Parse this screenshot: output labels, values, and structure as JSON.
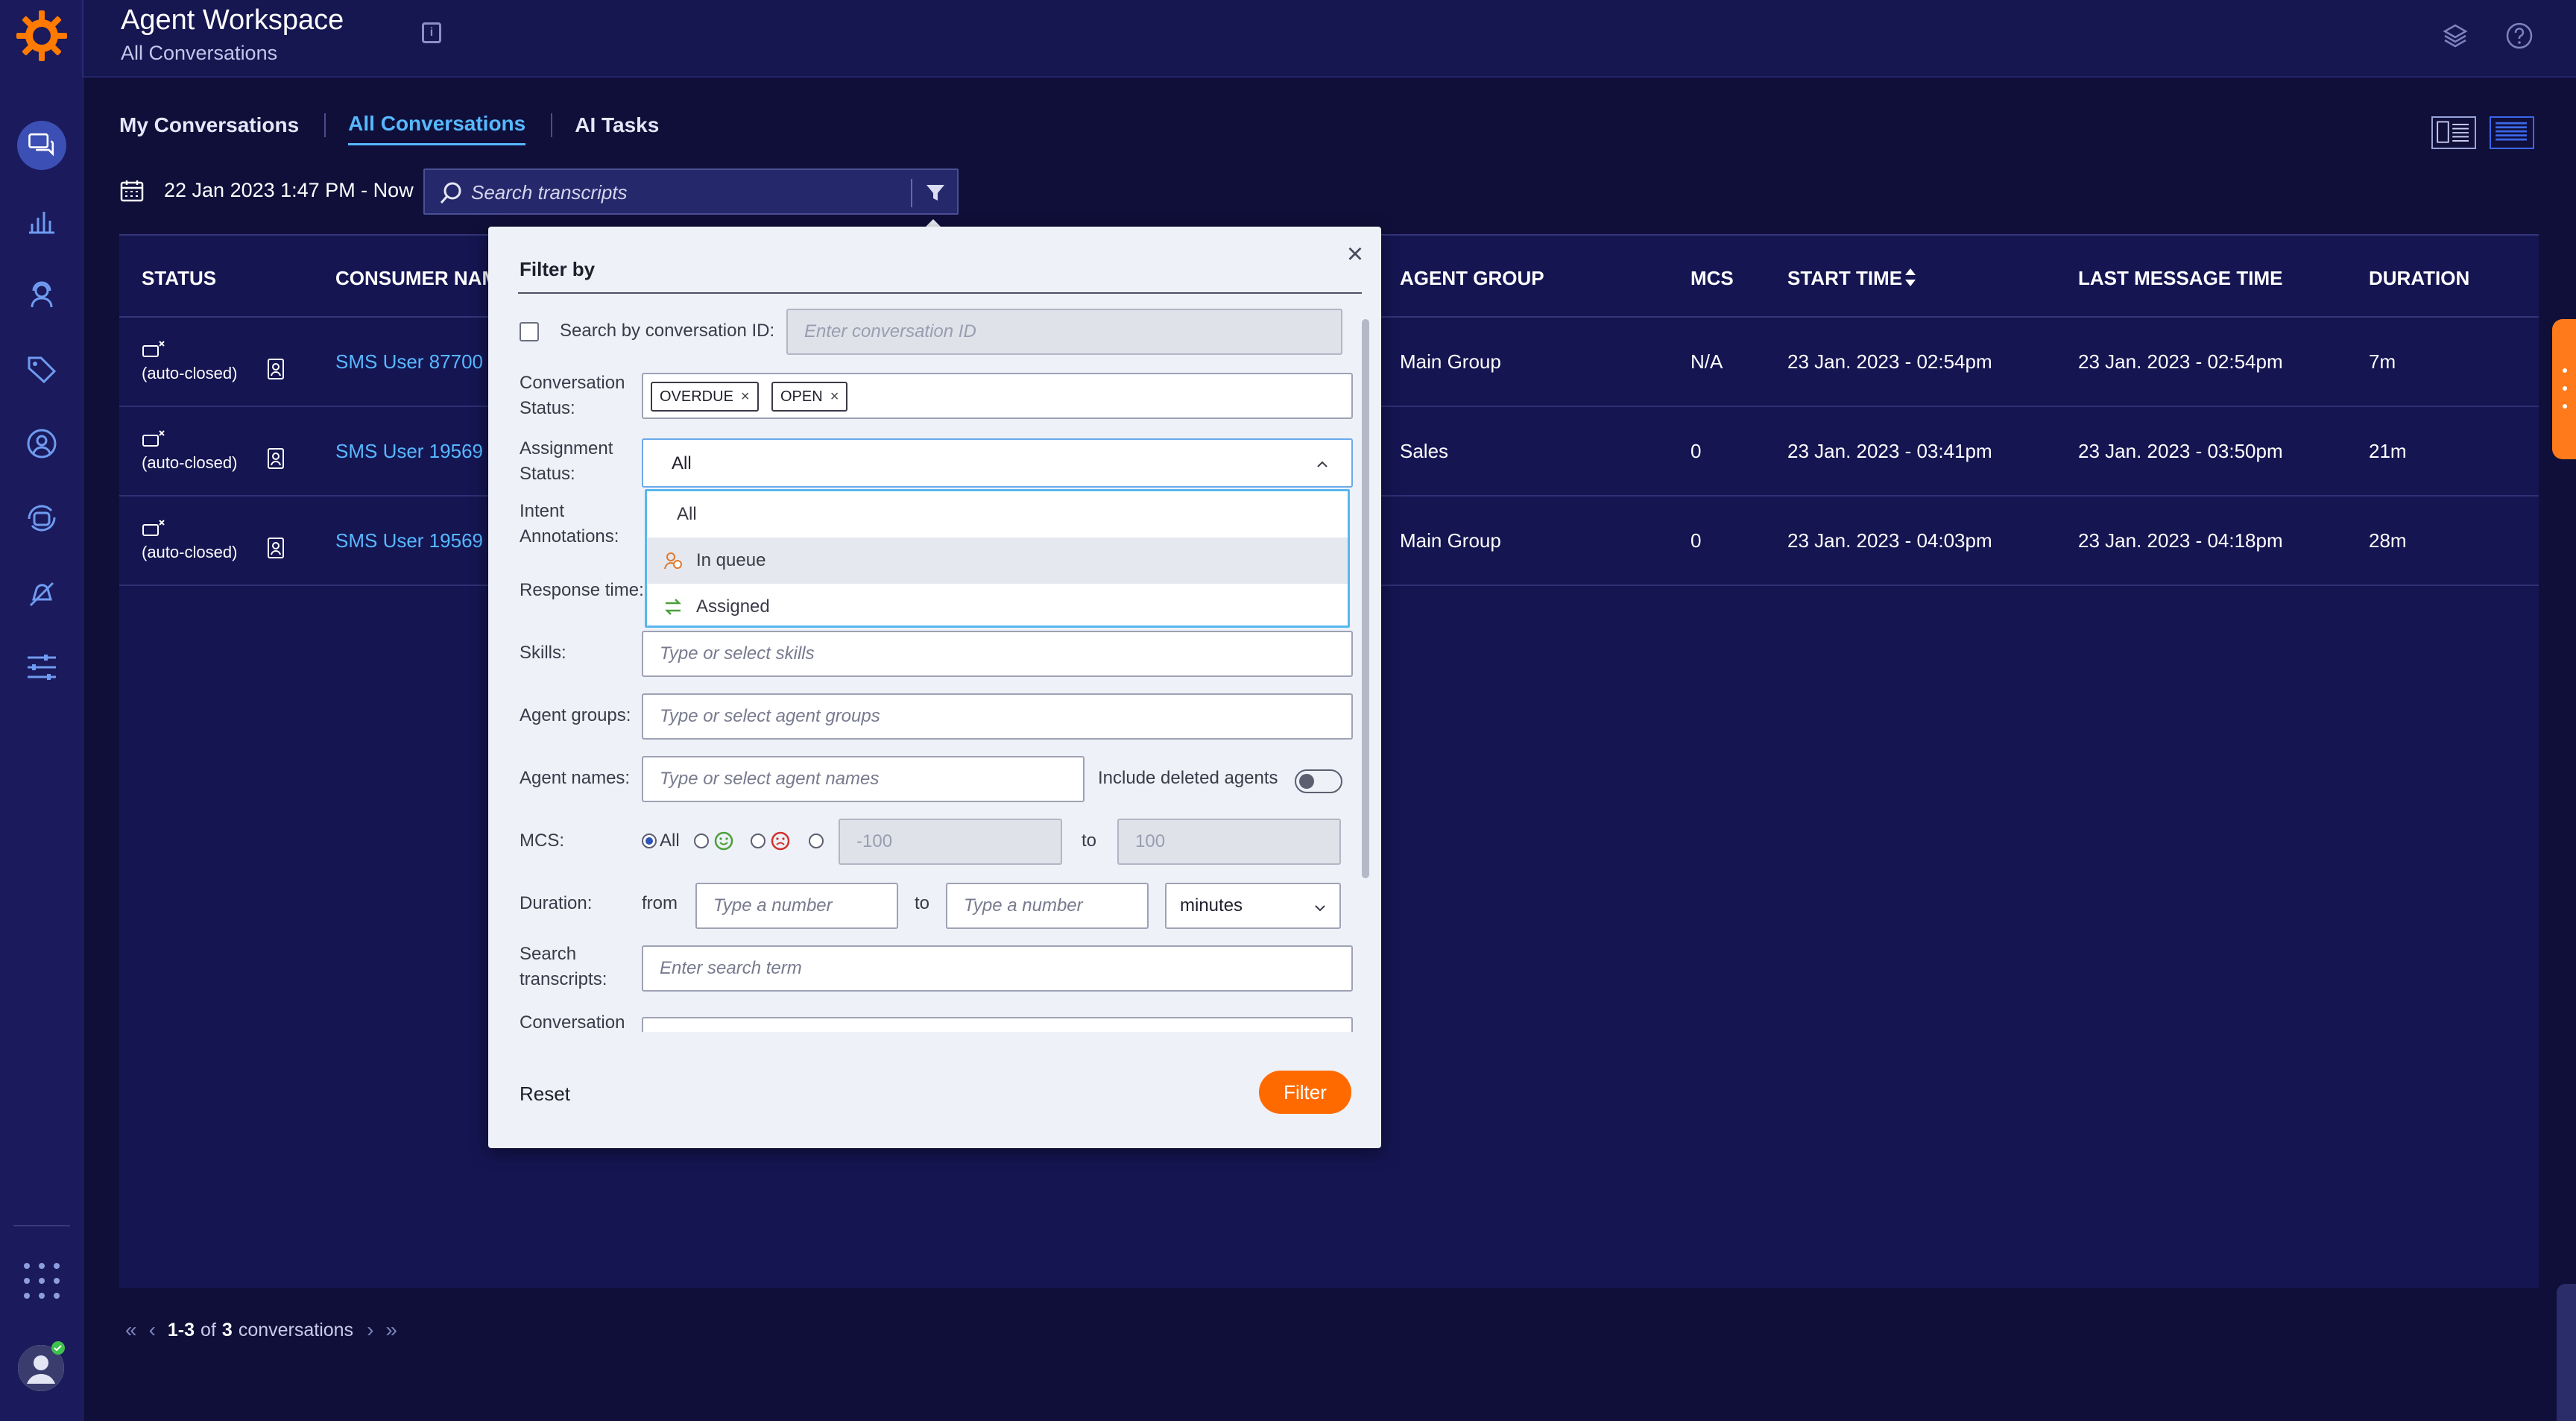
{
  "header": {
    "title": "Agent Workspace",
    "subtitle": "All Conversations"
  },
  "tabs": [
    {
      "label": "My Conversations",
      "active": false
    },
    {
      "label": "All Conversations",
      "active": true
    },
    {
      "label": "AI Tasks",
      "active": false
    }
  ],
  "date_range": "22 Jan 2023 1:47 PM - Now",
  "search": {
    "placeholder": "Search transcripts"
  },
  "table": {
    "columns": [
      "STATUS",
      "CONSUMER NAM",
      "AGENT GROUP",
      "MCS",
      "START TIME",
      "LAST MESSAGE TIME",
      "DURATION"
    ],
    "rows": [
      {
        "status": "(auto-closed)",
        "consumer": "SMS User 87700",
        "agent_group": "Main Group",
        "mcs": "N/A",
        "start": "23 Jan. 2023 - 02:54pm",
        "last": "23 Jan. 2023 - 02:54pm",
        "duration": "7m"
      },
      {
        "status": "(auto-closed)",
        "consumer": "SMS User 19569",
        "agent_group": "Sales",
        "mcs": "0",
        "start": "23 Jan. 2023 - 03:41pm",
        "last": "23 Jan. 2023 - 03:50pm",
        "duration": "21m"
      },
      {
        "status": "(auto-closed)",
        "consumer": "SMS User 19569",
        "agent_group": "Main Group",
        "mcs": "0",
        "start": "23 Jan. 2023 - 04:03pm",
        "last": "23 Jan. 2023 - 04:18pm",
        "duration": "28m"
      }
    ]
  },
  "pager": {
    "range": "1-3",
    "of": "of",
    "total": "3",
    "suffix": "conversations"
  },
  "filter": {
    "title": "Filter by",
    "conv_id_label": "Search by conversation ID:",
    "conv_id_placeholder": "Enter conversation ID",
    "conv_status_label_1": "Conversation",
    "conv_status_label_2": "Status:",
    "status_tags": [
      "OVERDUE",
      "OPEN"
    ],
    "assign_label_1": "Assignment",
    "assign_label_2": "Status:",
    "assign_value": "All",
    "assign_options": [
      "All",
      "In queue",
      "Assigned"
    ],
    "intent_label_1": "Intent",
    "intent_label_2": "Annotations:",
    "response_label": "Response time:",
    "skills_label": "Skills:",
    "skills_placeholder": "Type or select skills",
    "agent_groups_label": "Agent groups:",
    "agent_groups_placeholder": "Type or select agent groups",
    "agent_names_label": "Agent names:",
    "agent_names_placeholder": "Type or select agent names",
    "include_deleted_label": "Include deleted agents",
    "mcs_label": "MCS:",
    "mcs_all": "All",
    "mcs_from": "-100",
    "mcs_to_label": "to",
    "mcs_to": "100",
    "duration_label": "Duration:",
    "duration_from_label": "from",
    "duration_from_placeholder": "Type a number",
    "duration_to_label": "to",
    "duration_to_placeholder": "Type a number",
    "duration_unit": "minutes",
    "search_label_1": "Search",
    "search_label_2": "transcripts:",
    "search_placeholder": "Enter search term",
    "conversation_label": "Conversation",
    "reset_label": "Reset",
    "filter_label": "Filter"
  },
  "colors": {
    "accent": "#57b8ff",
    "brand": "#ff6a00",
    "background": "#0f0f3a",
    "rail": "#1a1a5c"
  }
}
